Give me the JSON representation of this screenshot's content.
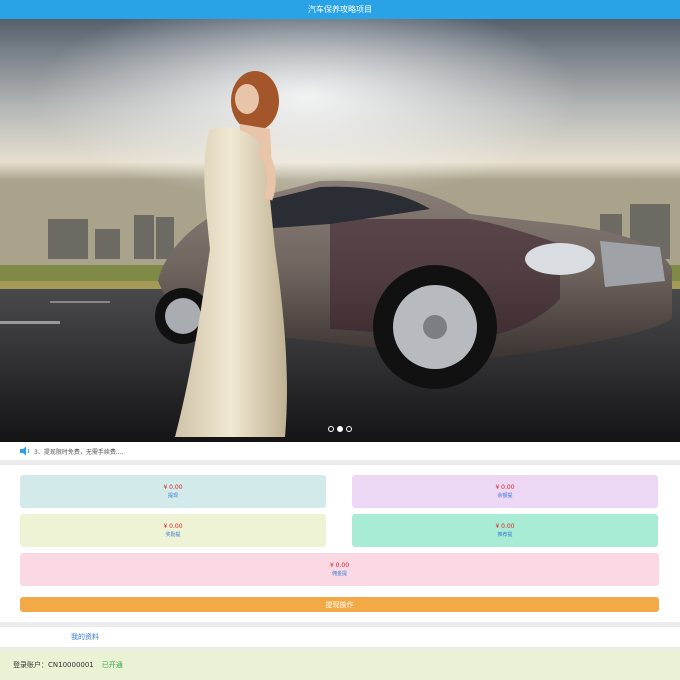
{
  "header": {
    "title": "汽车保养攻略项目"
  },
  "banner": {
    "slide_count": 3,
    "active_slide": 2
  },
  "notice": {
    "text": "3、提现限时免费，无需手续费...."
  },
  "cards": [
    {
      "amount": "¥ 0.00",
      "label": "提现",
      "color": "#d2ebea"
    },
    {
      "amount": "¥ 0.00",
      "label": "余额提",
      "color": "#ecd7f5"
    },
    {
      "amount": "¥ 0.00",
      "label": "奖励提",
      "color": "#eef3d6"
    },
    {
      "amount": "¥ 0.00",
      "label": "推荐提",
      "color": "#a9ecd6"
    },
    {
      "amount": "¥ 0.00",
      "label": "佣金提",
      "color": "#fbd9e4"
    }
  ],
  "action": {
    "label": "提现操作",
    "color": "#f2aa46"
  },
  "tabbar": {
    "my_profile": "我的资料"
  },
  "account": {
    "label": "登录账户：",
    "id": "CN10000001",
    "status": "已开通"
  },
  "colors": {
    "header": "#2aa3e6",
    "account_bg": "#e9f2d5",
    "amount": "#e02020"
  }
}
